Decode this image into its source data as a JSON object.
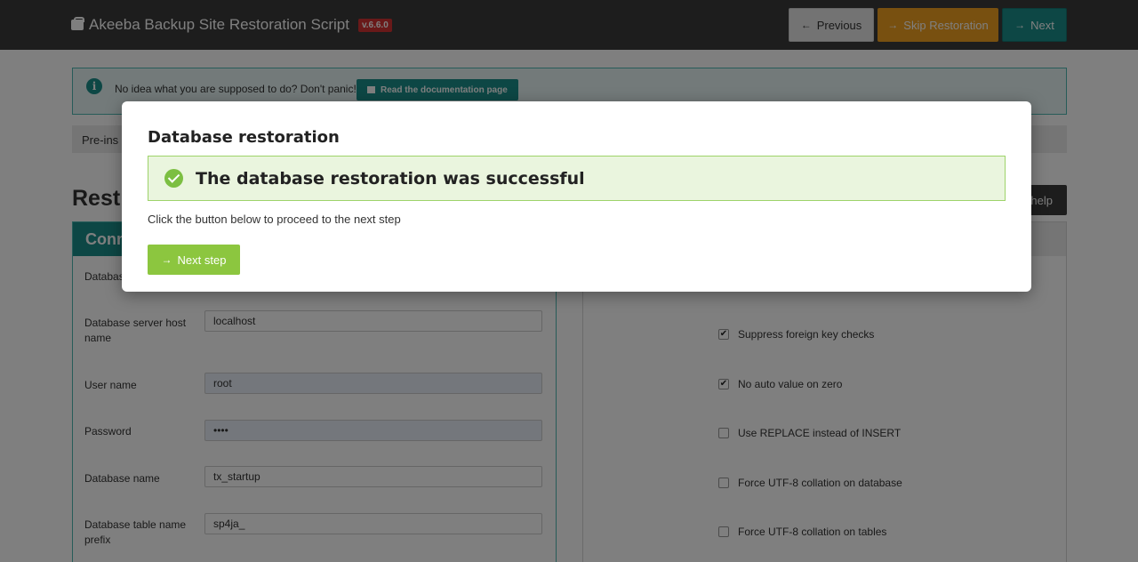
{
  "header": {
    "title": "Akeeba Backup Site Restoration Script",
    "version": "v.6.6.0",
    "previous_label": "Previous",
    "skip_label": "Skip Restoration",
    "next_label": "Next"
  },
  "info": {
    "text": "No idea what you are supposed to do? Don't panic!",
    "doc_button_label": "Read the documentation page"
  },
  "strip": {
    "text": "Pre-ins"
  },
  "page": {
    "section_title": "Rest",
    "help_label": "help",
    "left_panel_title": "Conn"
  },
  "form": {
    "fields": [
      {
        "label": "Databas",
        "value": ""
      },
      {
        "label": "Database server host name",
        "value": "localhost"
      },
      {
        "label": "User name",
        "value": "root"
      },
      {
        "label": "Password",
        "value": "••••"
      },
      {
        "label": "Database name",
        "value": "tx_startup"
      },
      {
        "label": "Database table name prefix",
        "value": "sp4ja_"
      }
    ]
  },
  "options": [
    {
      "label": "Suppress foreign key checks",
      "checked": true
    },
    {
      "label": "No auto value on zero",
      "checked": true
    },
    {
      "label": "Use REPLACE instead of INSERT",
      "checked": false
    },
    {
      "label": "Force UTF-8 collation on database",
      "checked": false
    },
    {
      "label": "Force UTF-8 collation on tables",
      "checked": false
    }
  ],
  "modal": {
    "title": "Database restoration",
    "success_message": "The database restoration was successful",
    "description": "Click the button below to proceed to the next step",
    "next_step_label": "Next step"
  },
  "colors": {
    "header_bg": "#3a3a3a",
    "teal": "#1b8f8a",
    "orange": "#f0a020",
    "success_green": "#8cc63f",
    "version_red": "#d23232"
  }
}
